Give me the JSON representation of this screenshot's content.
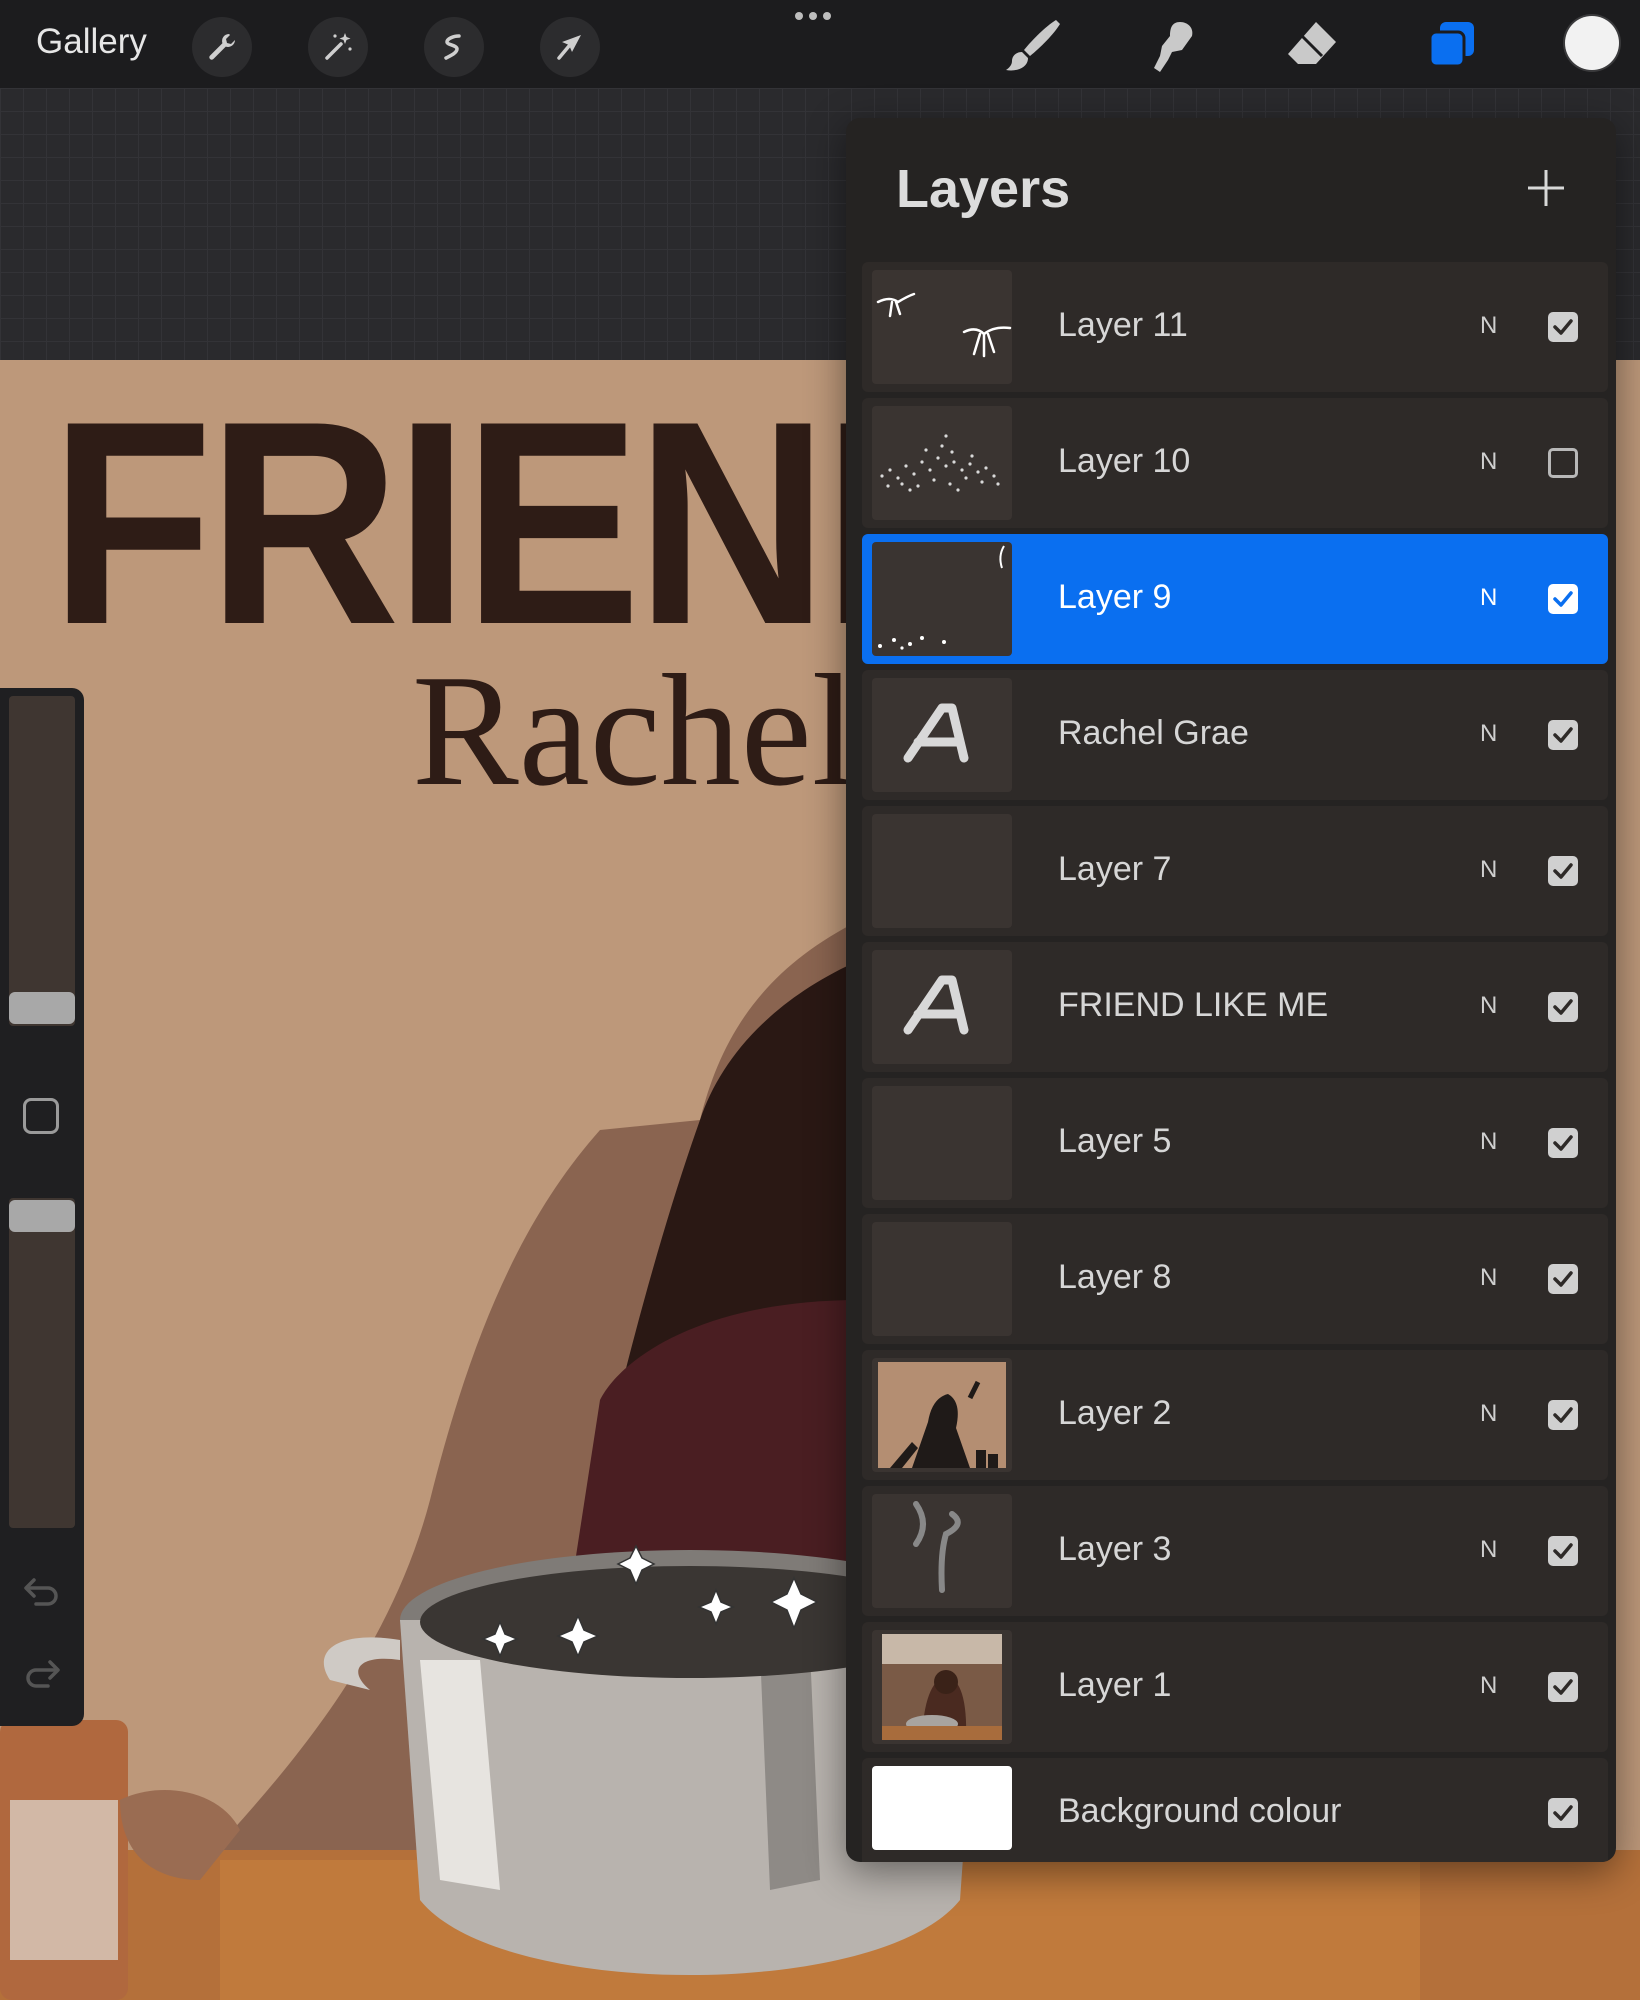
{
  "toolbar": {
    "gallery_label": "Gallery",
    "left_tools": [
      "wrench-icon",
      "magic-wand-icon",
      "selection-icon",
      "transform-arrow-icon"
    ],
    "right_tools": [
      "brush-icon",
      "smudge-icon",
      "eraser-icon",
      "layers-icon"
    ],
    "active_tool": "layers-icon",
    "accent_color": "#0a6ff0",
    "current_color": "#f2f2f2"
  },
  "canvas": {
    "title_text": "FRIEND I",
    "subtitle_text": "Rachel",
    "background_color": "#bd987a",
    "text_color": "#2e1c16"
  },
  "layers": {
    "title": "Layers",
    "add_icon": "plus-icon",
    "items": [
      {
        "name": "Layer 11",
        "blend": "N",
        "visible": true,
        "selected": false,
        "thumb": "bows"
      },
      {
        "name": "Layer 10",
        "blend": "N",
        "visible": false,
        "selected": false,
        "thumb": "glitter"
      },
      {
        "name": "Layer 9",
        "blend": "N",
        "visible": true,
        "selected": true,
        "thumb": "sparkles"
      },
      {
        "name": "Rachel Grae",
        "blend": "N",
        "visible": true,
        "selected": false,
        "thumb": "text"
      },
      {
        "name": "Layer 7",
        "blend": "N",
        "visible": true,
        "selected": false,
        "thumb": "empty"
      },
      {
        "name": "FRIEND LIKE ME",
        "blend": "N",
        "visible": true,
        "selected": false,
        "thumb": "text"
      },
      {
        "name": "Layer 5",
        "blend": "N",
        "visible": true,
        "selected": false,
        "thumb": "empty"
      },
      {
        "name": "Layer 8",
        "blend": "N",
        "visible": true,
        "selected": false,
        "thumb": "empty"
      },
      {
        "name": "Layer 2",
        "blend": "N",
        "visible": true,
        "selected": false,
        "thumb": "silhouette"
      },
      {
        "name": "Layer 3",
        "blend": "N",
        "visible": true,
        "selected": false,
        "thumb": "steam"
      },
      {
        "name": "Layer 1",
        "blend": "N",
        "visible": true,
        "selected": false,
        "thumb": "photo"
      },
      {
        "name": "Background colour",
        "blend": "",
        "visible": true,
        "selected": false,
        "thumb": "white"
      }
    ]
  },
  "sidebar": {
    "brush_size_level": 0.9,
    "opacity_level": 0.95,
    "modifier_icon": "square-modifier-icon",
    "undo_icon": "undo-icon",
    "redo_icon": "redo-icon"
  }
}
